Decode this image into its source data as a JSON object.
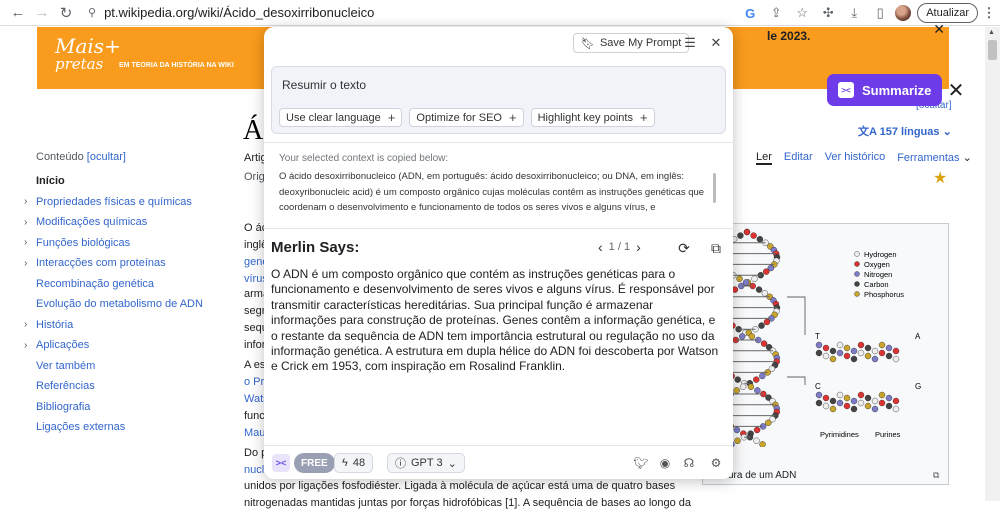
{
  "browser": {
    "url": "pt.wikipedia.org/wiki/Ácido_desoxirribonucleico",
    "update_label": "Atualizar"
  },
  "wiki": {
    "banner": {
      "logo_line1": "Mais+",
      "logo_line2": "pretas",
      "tagline": "EM TEORIA DA HISTÓRIA NA WIKI",
      "year_text": "le 2023."
    },
    "title_fragment": "Ác",
    "artigo_fragment": "Artig",
    "origem_fragment": "Origi",
    "languages": "157 línguas",
    "ocultar": "[ocultar]",
    "tabs": {
      "read": "Ler",
      "edit": "Editar",
      "history": "Ver histórico",
      "tools": "Ferramentas"
    },
    "toc": {
      "title": "Conteúdo",
      "hide": "[ocultar]",
      "items": [
        {
          "label": "Início",
          "active": true,
          "expandable": false
        },
        {
          "label": "Propriedades físicas e químicas",
          "expandable": true
        },
        {
          "label": "Modificações químicas",
          "expandable": true
        },
        {
          "label": "Funções biológicas",
          "expandable": true
        },
        {
          "label": "Interacções com proteínas",
          "expandable": true
        },
        {
          "label": "Recombinação genética",
          "expandable": false
        },
        {
          "label": "Evolução do metabolismo de ADN",
          "expandable": false
        },
        {
          "label": "História",
          "expandable": true
        },
        {
          "label": "Aplicações",
          "expandable": true
        },
        {
          "label": "Ver também",
          "expandable": false
        },
        {
          "label": "Referências",
          "expandable": false
        },
        {
          "label": "Bibliografia",
          "expandable": false
        },
        {
          "label": "Ligações externas",
          "expandable": false
        }
      ]
    },
    "fragments": [
      "O ác",
      "inglê",
      "gene",
      "vírus",
      "arma",
      "segr",
      "sequ",
      "infor",
      "A es",
      "o Pr",
      "Wats",
      "func",
      "Mau",
      "Do p",
      "nucl"
    ],
    "figure_legend": [
      "Hydrogen",
      "Oxygen",
      "Nitrogen",
      "Carbon",
      "Phosphorus"
    ],
    "figure_labels": {
      "t": "T",
      "a": "A",
      "c": "C",
      "g": "G",
      "pyrimidines": "Pyrimidines",
      "purines": "Purines"
    },
    "figure_caption": "ura de um ADN",
    "bottom_line_1": "unidos por ligações fosfodiéster. Ligada à molécula de açúcar está uma de quatro bases",
    "bottom_line_2": "nitrogenadas mantidas juntas por forças hidrofóbicas [1]. A sequência de bases ao longo da"
  },
  "merlin": {
    "save_prompt": "Save My Prompt",
    "prompt": "Resumir o texto",
    "chips": [
      "Use clear language",
      "Optimize for SEO",
      "Highlight key points"
    ],
    "context_label": "Your selected context is copied below:",
    "context_text": "O ácido desoxirribonucleico (ADN, em português: ácido desoxirribonucleico; ou DNA, em inglês: deoxyribonucleic acid) é um composto orgânico cujas moléculas contêm as instruções genéticas que coordenam o desenvolvimento e funcionamento de todos os seres vivos e alguns vírus, e",
    "says_title": "Merlin Says:",
    "pager": "1 / 1",
    "answer": "O ADN é um composto orgânico que contém as instruções genéticas para o funcionamento e desenvolvimento de seres vivos e alguns vírus. É responsável por transmitir características hereditárias. Sua principal função é armazenar informações para construção de proteínas. Genes contêm a informação genética, e o restante da sequência de ADN tem importância estrutural ou regulação no uso da informação genética. A estrutura em dupla hélice do ADN foi descoberta por Watson e Crick em 1953, com inspiração em Rosalind Franklin.",
    "footer": {
      "free": "FREE",
      "credits": "48",
      "model": "GPT 3"
    }
  },
  "summarize_label": "Summarize",
  "colors": {
    "merlin_purple": "#6d3ce8",
    "banner_orange": "#f99b1c",
    "wiki_link": "#3366cc"
  }
}
